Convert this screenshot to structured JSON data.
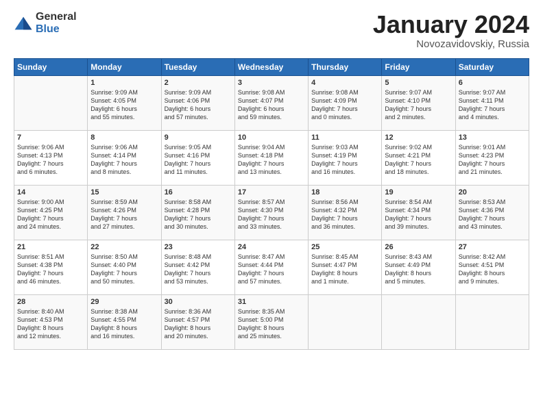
{
  "header": {
    "logo_general": "General",
    "logo_blue": "Blue",
    "month": "January 2024",
    "location": "Novozavidovskiy, Russia"
  },
  "weekdays": [
    "Sunday",
    "Monday",
    "Tuesday",
    "Wednesday",
    "Thursday",
    "Friday",
    "Saturday"
  ],
  "weeks": [
    [
      {
        "day": "",
        "text": ""
      },
      {
        "day": "1",
        "text": "Sunrise: 9:09 AM\nSunset: 4:05 PM\nDaylight: 6 hours\nand 55 minutes."
      },
      {
        "day": "2",
        "text": "Sunrise: 9:09 AM\nSunset: 4:06 PM\nDaylight: 6 hours\nand 57 minutes."
      },
      {
        "day": "3",
        "text": "Sunrise: 9:08 AM\nSunset: 4:07 PM\nDaylight: 6 hours\nand 59 minutes."
      },
      {
        "day": "4",
        "text": "Sunrise: 9:08 AM\nSunset: 4:09 PM\nDaylight: 7 hours\nand 0 minutes."
      },
      {
        "day": "5",
        "text": "Sunrise: 9:07 AM\nSunset: 4:10 PM\nDaylight: 7 hours\nand 2 minutes."
      },
      {
        "day": "6",
        "text": "Sunrise: 9:07 AM\nSunset: 4:11 PM\nDaylight: 7 hours\nand 4 minutes."
      }
    ],
    [
      {
        "day": "7",
        "text": "Sunrise: 9:06 AM\nSunset: 4:13 PM\nDaylight: 7 hours\nand 6 minutes."
      },
      {
        "day": "8",
        "text": "Sunrise: 9:06 AM\nSunset: 4:14 PM\nDaylight: 7 hours\nand 8 minutes."
      },
      {
        "day": "9",
        "text": "Sunrise: 9:05 AM\nSunset: 4:16 PM\nDaylight: 7 hours\nand 11 minutes."
      },
      {
        "day": "10",
        "text": "Sunrise: 9:04 AM\nSunset: 4:18 PM\nDaylight: 7 hours\nand 13 minutes."
      },
      {
        "day": "11",
        "text": "Sunrise: 9:03 AM\nSunset: 4:19 PM\nDaylight: 7 hours\nand 16 minutes."
      },
      {
        "day": "12",
        "text": "Sunrise: 9:02 AM\nSunset: 4:21 PM\nDaylight: 7 hours\nand 18 minutes."
      },
      {
        "day": "13",
        "text": "Sunrise: 9:01 AM\nSunset: 4:23 PM\nDaylight: 7 hours\nand 21 minutes."
      }
    ],
    [
      {
        "day": "14",
        "text": "Sunrise: 9:00 AM\nSunset: 4:25 PM\nDaylight: 7 hours\nand 24 minutes."
      },
      {
        "day": "15",
        "text": "Sunrise: 8:59 AM\nSunset: 4:26 PM\nDaylight: 7 hours\nand 27 minutes."
      },
      {
        "day": "16",
        "text": "Sunrise: 8:58 AM\nSunset: 4:28 PM\nDaylight: 7 hours\nand 30 minutes."
      },
      {
        "day": "17",
        "text": "Sunrise: 8:57 AM\nSunset: 4:30 PM\nDaylight: 7 hours\nand 33 minutes."
      },
      {
        "day": "18",
        "text": "Sunrise: 8:56 AM\nSunset: 4:32 PM\nDaylight: 7 hours\nand 36 minutes."
      },
      {
        "day": "19",
        "text": "Sunrise: 8:54 AM\nSunset: 4:34 PM\nDaylight: 7 hours\nand 39 minutes."
      },
      {
        "day": "20",
        "text": "Sunrise: 8:53 AM\nSunset: 4:36 PM\nDaylight: 7 hours\nand 43 minutes."
      }
    ],
    [
      {
        "day": "21",
        "text": "Sunrise: 8:51 AM\nSunset: 4:38 PM\nDaylight: 7 hours\nand 46 minutes."
      },
      {
        "day": "22",
        "text": "Sunrise: 8:50 AM\nSunset: 4:40 PM\nDaylight: 7 hours\nand 50 minutes."
      },
      {
        "day": "23",
        "text": "Sunrise: 8:48 AM\nSunset: 4:42 PM\nDaylight: 7 hours\nand 53 minutes."
      },
      {
        "day": "24",
        "text": "Sunrise: 8:47 AM\nSunset: 4:44 PM\nDaylight: 7 hours\nand 57 minutes."
      },
      {
        "day": "25",
        "text": "Sunrise: 8:45 AM\nSunset: 4:47 PM\nDaylight: 8 hours\nand 1 minute."
      },
      {
        "day": "26",
        "text": "Sunrise: 8:43 AM\nSunset: 4:49 PM\nDaylight: 8 hours\nand 5 minutes."
      },
      {
        "day": "27",
        "text": "Sunrise: 8:42 AM\nSunset: 4:51 PM\nDaylight: 8 hours\nand 9 minutes."
      }
    ],
    [
      {
        "day": "28",
        "text": "Sunrise: 8:40 AM\nSunset: 4:53 PM\nDaylight: 8 hours\nand 12 minutes."
      },
      {
        "day": "29",
        "text": "Sunrise: 8:38 AM\nSunset: 4:55 PM\nDaylight: 8 hours\nand 16 minutes."
      },
      {
        "day": "30",
        "text": "Sunrise: 8:36 AM\nSunset: 4:57 PM\nDaylight: 8 hours\nand 20 minutes."
      },
      {
        "day": "31",
        "text": "Sunrise: 8:35 AM\nSunset: 5:00 PM\nDaylight: 8 hours\nand 25 minutes."
      },
      {
        "day": "",
        "text": ""
      },
      {
        "day": "",
        "text": ""
      },
      {
        "day": "",
        "text": ""
      }
    ]
  ]
}
